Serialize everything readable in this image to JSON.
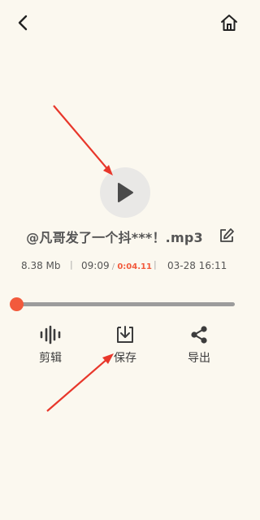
{
  "header": {
    "back_icon": "back-chevron-icon",
    "home_icon": "home-icon"
  },
  "player": {
    "play_icon": "play-icon",
    "title": "@凡哥发了一个抖***！.mp3",
    "edit_icon": "edit-icon",
    "file_size": "8.38 Mb",
    "duration": "09:09",
    "duration_sep": " / ",
    "position": "0:04.11",
    "date": "03-28 16:11",
    "progress_fraction": 0.0,
    "accent_color": "#f25a3c"
  },
  "actions": [
    {
      "label": "剪辑",
      "icon": "waveform-icon"
    },
    {
      "label": "保存",
      "icon": "download-tray-icon"
    },
    {
      "label": "导出",
      "icon": "share-icon"
    }
  ],
  "annotations": {
    "arrow_color": "#e8372b"
  }
}
